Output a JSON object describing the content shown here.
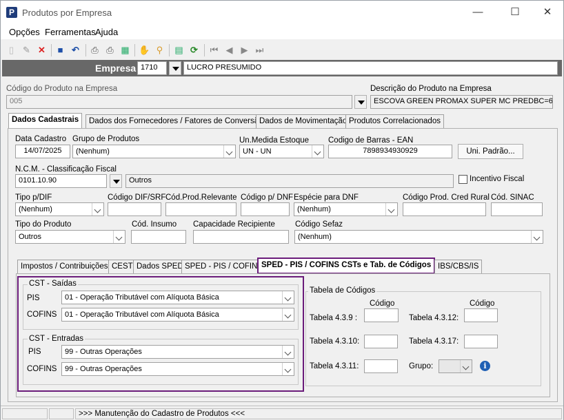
{
  "window": {
    "title": "Produtos por Empresa",
    "minimize": "—",
    "maximize": "☐",
    "close": "✕"
  },
  "menu": [
    "Opções",
    "Ferramentas",
    "Ajuda"
  ],
  "empresa": {
    "label": "Empresa",
    "code": "1710",
    "name": "LUCRO PRESUMIDO"
  },
  "produto": {
    "codigo_label": "Código do Produto na Empresa",
    "codigo_value": "005",
    "descricao_label": "Descrição do Produto na Empresa",
    "descricao_value": "ESCOVA GREEN PROMAX SUPER MC PREDBC=65%"
  },
  "tabs": [
    "Dados Cadastrais",
    "Dados dos Fornecedores / Fatores de Conversão",
    "Dados de Movimentação",
    "Produtos Correlacionados"
  ],
  "cadastro": {
    "data_cadastro_label": "Data Cadastro",
    "data_cadastro_value": "14/07/2025",
    "grupo_label": "Grupo de Produtos",
    "grupo_value": "(Nenhum)",
    "un_label": "Un.Medida Estoque",
    "un_value": "UN - UN",
    "ean_label": "Codigo de Barras - EAN",
    "ean_value": "7898934930929",
    "uni_padrao_btn": "Uni. Padrão...",
    "ncm_label": "N.C.M. -  Classificação Fiscal",
    "ncm_code": "0101.10.90",
    "ncm_desc": "Outros",
    "incentivo_label": "Incentivo Fiscal",
    "tipo_dif_label": "Tipo p/DIF",
    "tipo_dif_value": "(Nenhum)",
    "cod_dif_label": "Código DIF/SRF",
    "cod_prod_relevante_label": "Cód.Prod.Relevante",
    "cod_dnf_label": "Código p/ DNF",
    "especie_dnf_label": "Espécie para DNF",
    "especie_dnf_value": "(Nenhum)",
    "cod_cred_rural_label": "Código Prod. Cred Rural",
    "cod_sinac_label": "Cód. SINAC",
    "tipo_produto_label": "Tipo do Produto",
    "tipo_produto_value": "Outros",
    "cod_insumo_label": "Cód. Insumo",
    "capacidade_label": "Capacidade Recipiente",
    "cod_sefaz_label": "Código Sefaz",
    "cod_sefaz_value": "(Nenhum)"
  },
  "subtabs": [
    "Impostos / Contribuições",
    "CEST",
    "Dados SPED",
    "SPED - PIS / COFINS",
    "SPED - PIS / COFINS CSTs e Tab. de Códigos",
    "IBS/CBS/IS"
  ],
  "cst": {
    "saidas_label": "CST - Saídas",
    "entradas_label": "CST - Entradas",
    "pis_label": "PIS",
    "cofins_label": "COFINS",
    "saidas_pis": "01 - Operação Tributável com Alíquota Básica",
    "saidas_cofins": "01 - Operação Tributável com Alíquota Básica",
    "entradas_pis": "99 - Outras Operações",
    "entradas_cofins": "99 - Outras Operações"
  },
  "tabela": {
    "title": "Tabela de Códigos",
    "codigo_label": "Código",
    "t439": "Tabela 4.3.9 :",
    "t4310": "Tabela 4.3.10:",
    "t4311": "Tabela 4.3.11:",
    "t4312": "Tabela 4.3.12:",
    "t4317": "Tabela 4.3.17:",
    "grupo": "Grupo:"
  },
  "status": {
    "message": ">>> Manutenção do Cadastro de Produtos <<<"
  },
  "colors": {
    "highlight": "#6a1b7a",
    "empresa_bar": "#686868"
  }
}
